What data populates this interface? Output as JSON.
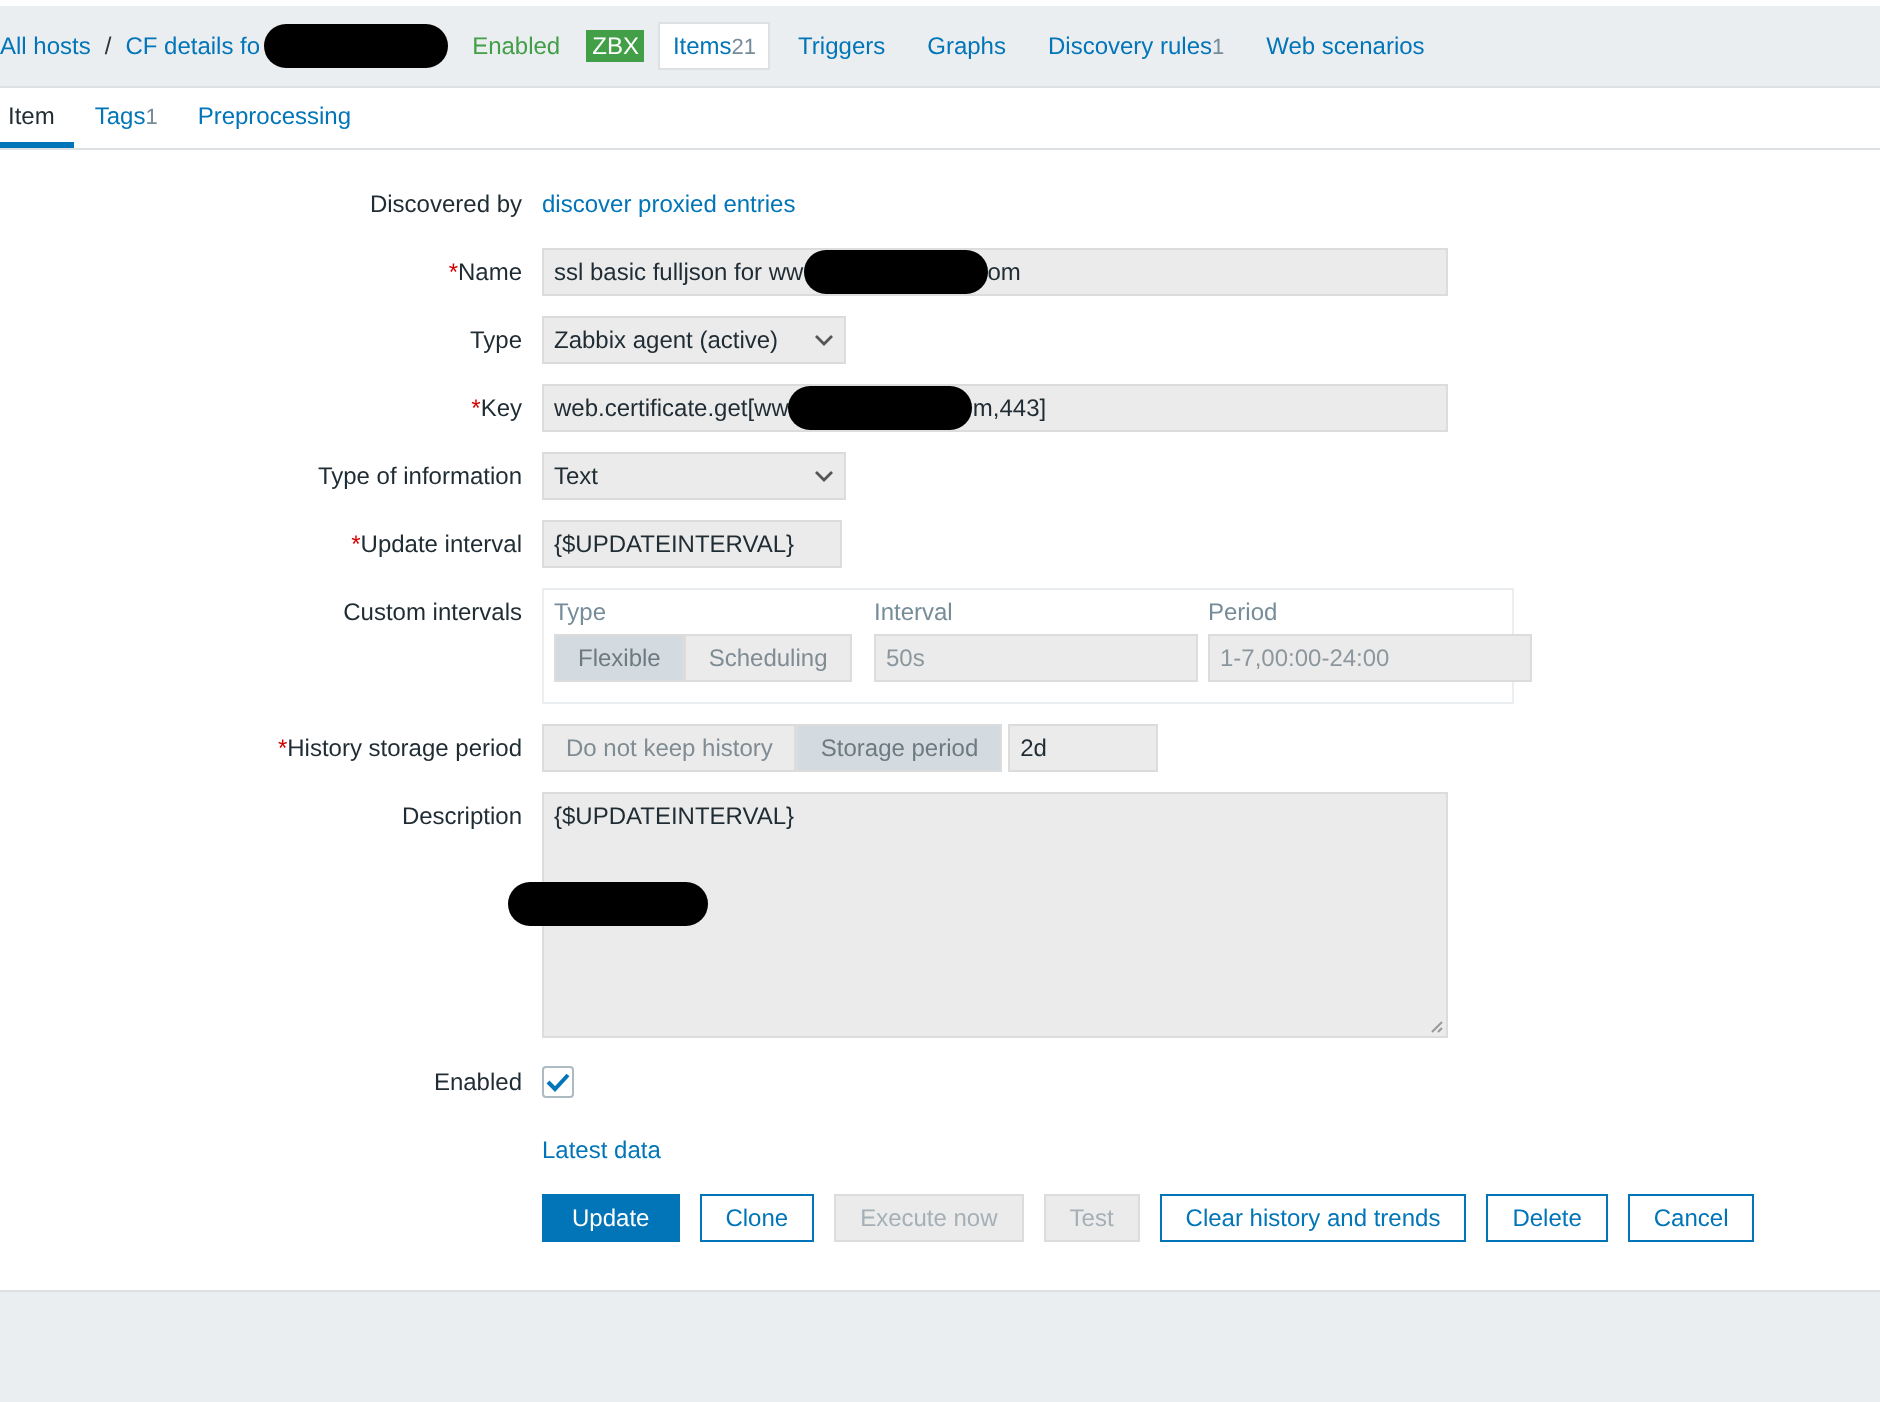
{
  "header": {
    "breadcrumb": [
      {
        "label": "All hosts",
        "redacted": false
      },
      {
        "label": "CF details fo",
        "redacted": true
      }
    ],
    "separator": "/",
    "status": "Enabled",
    "badge": "ZBX",
    "nav": [
      {
        "label": "Items",
        "count": "21",
        "selected": true
      },
      {
        "label": "Triggers",
        "selected": false
      },
      {
        "label": "Graphs",
        "selected": false
      },
      {
        "label": "Discovery rules",
        "count": "1",
        "selected": false
      },
      {
        "label": "Web scenarios",
        "selected": false
      }
    ]
  },
  "tabs": [
    {
      "label": "Item",
      "selected": true
    },
    {
      "label": "Tags",
      "count": "1",
      "selected": false
    },
    {
      "label": "Preprocessing",
      "selected": false
    }
  ],
  "form": [
    {
      "kind": "link",
      "label": "Discovered by",
      "required": false,
      "value": "discover proxied entries"
    },
    {
      "kind": "text",
      "label": "Name",
      "required": true,
      "parts": [
        "ssl basic fulljson for ww",
        "om"
      ]
    },
    {
      "kind": "select",
      "label": "Type",
      "required": false,
      "value": "Zabbix agent (active)"
    },
    {
      "kind": "text",
      "label": "Key",
      "required": true,
      "parts": [
        "web.certificate.get[ww",
        "m,443]"
      ]
    },
    {
      "kind": "select",
      "label": "Type of information",
      "required": false,
      "value": "Text"
    },
    {
      "kind": "short_text",
      "label": "Update interval",
      "required": true,
      "parts": [
        "{$UPDATEINTERVAL}"
      ]
    },
    {
      "kind": "intervals",
      "label": "Custom intervals",
      "required": false,
      "headers": [
        "Type",
        "Interval",
        "Period"
      ],
      "options": [
        {
          "label": "Flexible",
          "selected": true
        },
        {
          "label": "Scheduling",
          "selected": false
        }
      ],
      "interval": "50s",
      "period": "1-7,00:00-24:00"
    },
    {
      "kind": "history",
      "label": "History storage period",
      "required": true,
      "options": [
        {
          "label": "Do not keep history",
          "selected": false
        },
        {
          "label": "Storage period",
          "selected": true
        }
      ],
      "value": "2d"
    },
    {
      "kind": "textarea",
      "label": "Description",
      "required": false,
      "value": "{$UPDATEINTERVAL}"
    },
    {
      "kind": "checkbox",
      "label": "Enabled",
      "required": false,
      "checked": true
    },
    {
      "kind": "link",
      "value": "Latest data"
    }
  ],
  "required_mark": "*",
  "buttons": [
    {
      "label": "Update",
      "kind": "primary",
      "disabled": false
    },
    {
      "label": "Clone",
      "kind": "secondary",
      "disabled": false
    },
    {
      "label": "Execute now",
      "kind": "secondary",
      "disabled": true
    },
    {
      "label": "Test",
      "kind": "secondary",
      "disabled": true
    },
    {
      "label": "Clear history and trends",
      "kind": "secondary",
      "disabled": false
    },
    {
      "label": "Delete",
      "kind": "secondary",
      "disabled": false
    },
    {
      "label": "Cancel",
      "kind": "secondary",
      "disabled": false
    }
  ]
}
